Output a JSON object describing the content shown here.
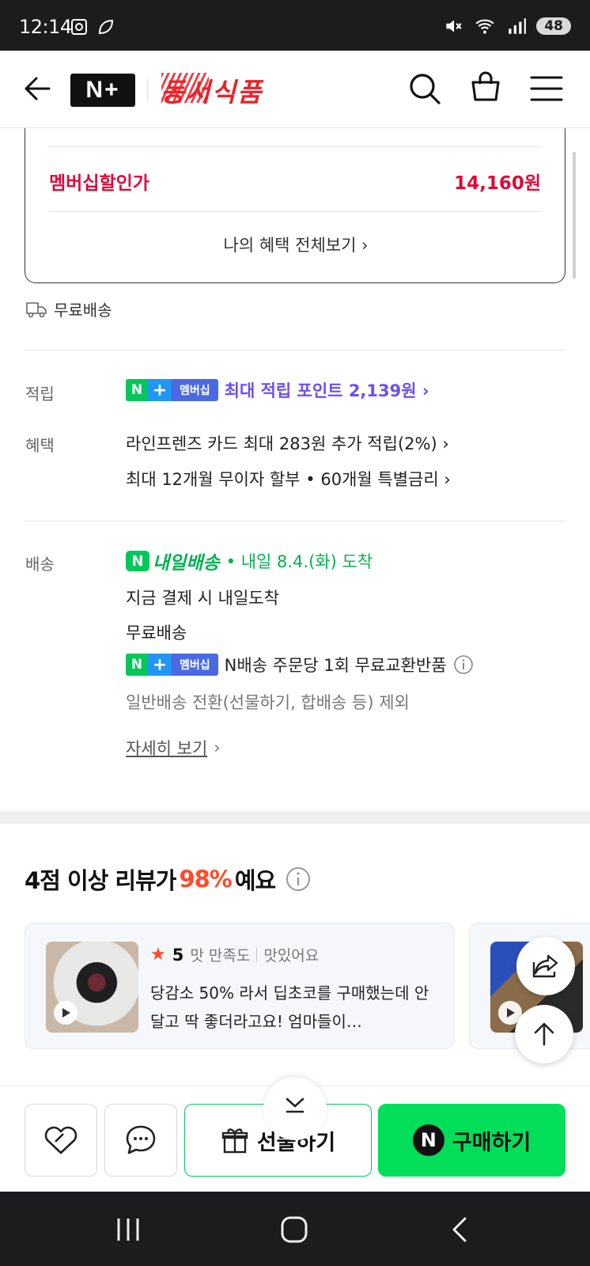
{
  "status_bar": {
    "time": "12:14",
    "battery": "48"
  },
  "header": {
    "nplus_logo": "N+",
    "brand_logo": "동서식품"
  },
  "benefit_box": {
    "member_price_label": "멤버십할인가",
    "member_price": "14,160원",
    "view_all": "나의 혜택 전체보기 ›"
  },
  "free_shipping_top": "무료배송",
  "points": {
    "label": "적립",
    "badge": {
      "n": "N",
      "plus": "+",
      "member": "멤버십"
    },
    "text": "최대 적립 포인트 2,139원 ›"
  },
  "benefits": {
    "label": "혜택",
    "line1": "라인프렌즈 카드 최대 283원 추가 적립(2%) ›",
    "line2": "최대 12개월 무이자 할부 • 60개월 특별금리 ›"
  },
  "delivery": {
    "label": "배송",
    "nday_n": "N",
    "nday_label": "내일배송",
    "arrival": "• 내일 8.4.(화) 도착",
    "line_pay_now": "지금 결제 시 내일도착",
    "line_free": "무료배송",
    "badge": {
      "n": "N",
      "plus": "+",
      "member": "멤버십"
    },
    "exchange_text": "N배송 주문당 1회 무료교환반품",
    "exclusion": "일반배송 전환(선물하기, 합배송 등) 제외",
    "details_link": "자세히 보기",
    "details_chevron": "›"
  },
  "reviews": {
    "title_prefix": "4점 이상 리뷰가 ",
    "title_pct": "98%",
    "title_suffix": "예요",
    "card1": {
      "star": "★",
      "score": "5",
      "taste_label": "맛 만족도",
      "taste_value": "맛있어요",
      "text": "당감소 50% 라서 딥초코를 구매했는데 안달고 딱 좋더라고요! 엄마들이…"
    }
  },
  "actions": {
    "gift_label": "선물하기",
    "buy_n": "N",
    "buy_label": "구매하기"
  },
  "colors": {
    "naver_green": "#03c75a",
    "buy_green": "#03de5a",
    "member_red": "#e0093a",
    "point_purple": "#6d4ef2",
    "review_orange": "#ff4b27"
  }
}
